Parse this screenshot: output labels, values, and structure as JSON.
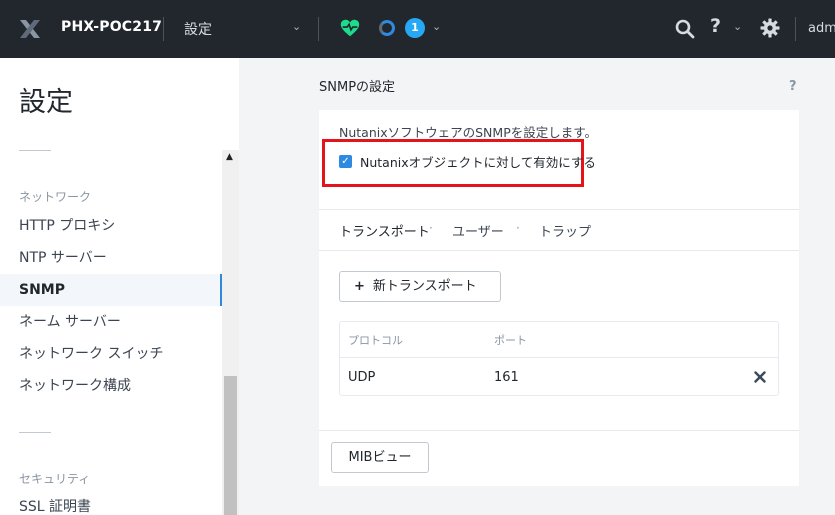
{
  "header": {
    "cluster_name": "PHX-POC217",
    "menu_label": "設定",
    "alert_count": "1",
    "user_label": "adm"
  },
  "sidebar": {
    "title": "設定",
    "sections": [
      {
        "label": "ネットワーク"
      },
      {
        "label": "セキュリティ"
      }
    ],
    "items": [
      {
        "label": "HTTP プロキシ"
      },
      {
        "label": "NTP サーバー"
      },
      {
        "label": "SNMP",
        "active": true
      },
      {
        "label": "ネーム サーバー"
      },
      {
        "label": "ネットワーク スイッチ"
      },
      {
        "label": "ネットワーク構成"
      },
      {
        "label": "SSL 証明書"
      }
    ]
  },
  "main": {
    "title": "SNMPの設定",
    "help": "?",
    "description": "NutanixソフトウェアのSNMPを設定します。",
    "enable_label": "Nutanixオブジェクトに対して有効にする",
    "enable_checked": true,
    "tabs": [
      {
        "label": "トランスポート",
        "active": true
      },
      {
        "label": "ユーザー"
      },
      {
        "label": "トラップ"
      }
    ],
    "tab_separator": "·",
    "new_transport_label": "新トランスポート",
    "table": {
      "columns": [
        "プロトコル",
        "ポート"
      ],
      "rows": [
        {
          "protocol": "UDP",
          "port": "161"
        }
      ]
    },
    "mib_button": "MIBビュー"
  },
  "colors": {
    "topbar": "#22272e",
    "accent": "#2d8ae0",
    "health": "#1fdc8c",
    "highlight": "#e3151a"
  }
}
